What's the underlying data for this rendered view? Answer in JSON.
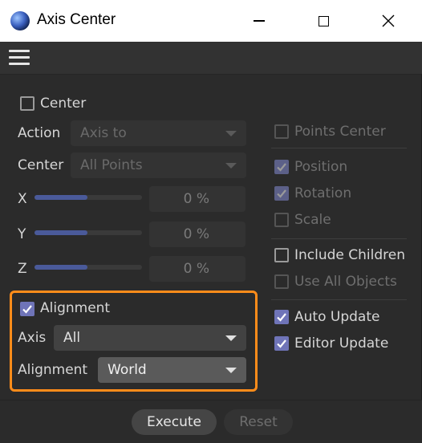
{
  "window": {
    "title": "Axis Center"
  },
  "left": {
    "center_check": {
      "label": "Center",
      "checked": false
    },
    "action": {
      "label": "Action",
      "value": "Axis to"
    },
    "center_mode": {
      "label": "Center",
      "value": "All Points"
    },
    "x": {
      "label": "X",
      "value": "0 %"
    },
    "y": {
      "label": "Y",
      "value": "0 %"
    },
    "z": {
      "label": "Z",
      "value": "0 %"
    },
    "alignment_check": {
      "label": "Alignment",
      "checked": true
    },
    "axis": {
      "label": "Axis",
      "value": "All"
    },
    "alignment": {
      "label": "Alignment",
      "value": "World"
    }
  },
  "right": {
    "points_center": {
      "label": "Points Center",
      "checked": false
    },
    "position": {
      "label": "Position",
      "checked": true
    },
    "rotation": {
      "label": "Rotation",
      "checked": true
    },
    "scale": {
      "label": "Scale",
      "checked": false
    },
    "include_children": {
      "label": "Include Children",
      "checked": false
    },
    "use_all_objects": {
      "label": "Use All Objects",
      "checked": false
    },
    "auto_update": {
      "label": "Auto Update",
      "checked": true
    },
    "editor_update": {
      "label": "Editor Update",
      "checked": true
    }
  },
  "buttons": {
    "execute": "Execute",
    "reset": "Reset"
  },
  "colors": {
    "accent": "#6f74b8",
    "highlight": "#ff8c1a"
  }
}
